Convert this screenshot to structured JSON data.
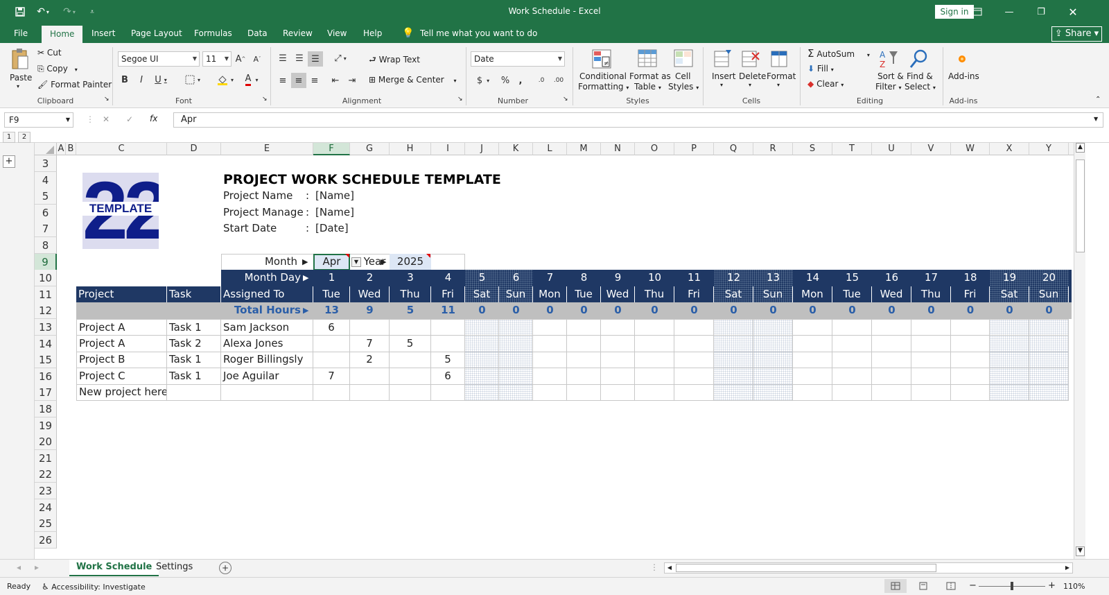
{
  "app": {
    "title": "Work Schedule  -  Excel",
    "sign_in": "Sign in",
    "share": "Share"
  },
  "tabs": [
    "File",
    "Home",
    "Insert",
    "Page Layout",
    "Formulas",
    "Data",
    "Review",
    "View",
    "Help"
  ],
  "tell_me": "Tell me what you want to do",
  "ribbon": {
    "clipboard": {
      "paste": "Paste",
      "cut": "Cut",
      "copy": "Copy",
      "format_painter": "Format Painter",
      "label": "Clipboard"
    },
    "font": {
      "name": "Segoe UI",
      "size": "11",
      "label": "Font"
    },
    "alignment": {
      "wrap_text": "Wrap Text",
      "merge_center": "Merge & Center",
      "label": "Alignment"
    },
    "number": {
      "format": "Date",
      "label": "Number"
    },
    "styles": {
      "conditional": "Conditional",
      "formatting": "Formatting",
      "format_as": "Format as",
      "table": "Table",
      "cell": "Cell",
      "styles_txt": "Styles",
      "label": "Styles"
    },
    "cells": {
      "insert": "Insert",
      "delete": "Delete",
      "format": "Format",
      "label": "Cells"
    },
    "editing": {
      "autosum": "AutoSum",
      "fill": "Fill",
      "clear": "Clear",
      "sort": "Sort &",
      "filter": "Filter",
      "find": "Find &",
      "select": "Select",
      "label": "Editing"
    },
    "addins": {
      "addins": "Add-ins",
      "label": "Add-ins"
    }
  },
  "formula_bar": {
    "name_box": "F9",
    "value": "Apr"
  },
  "outline_levels": [
    "1",
    "2"
  ],
  "columns": [
    "A",
    "B",
    "C",
    "D",
    "E",
    "F",
    "G",
    "H",
    "I",
    "J",
    "K",
    "L",
    "M",
    "N",
    "O",
    "P",
    "Q",
    "R",
    "S",
    "T",
    "U",
    "V",
    "W",
    "X",
    "Y"
  ],
  "rows": [
    "3",
    "4",
    "5",
    "6",
    "7",
    "8",
    "9",
    "10",
    "11",
    "12",
    "13",
    "14",
    "15",
    "16",
    "17",
    "18",
    "19",
    "20",
    "21",
    "22",
    "23",
    "24",
    "25",
    "26"
  ],
  "sheet": {
    "logo_text": "TEMPLATE",
    "logo_number": "22",
    "title": "PROJECT WORK SCHEDULE TEMPLATE",
    "info": [
      {
        "label": "Project Name",
        "sep": ":",
        "value": "[Name]"
      },
      {
        "label": "Project Manager",
        "sep": ":",
        "value": "[Name]"
      },
      {
        "label": "Start Date",
        "sep": ":",
        "value": "[Date]"
      }
    ],
    "month_label": "Month",
    "month_value": "Apr",
    "year_label": "Year",
    "year_value": "2025",
    "month_day_label": "Month Day",
    "headers": {
      "project": "Project",
      "task": "Task",
      "assigned": "Assigned To"
    },
    "total_hours_label": "Total Hours",
    "days": [
      "1",
      "2",
      "3",
      "4",
      "5",
      "6",
      "7",
      "8",
      "9",
      "10",
      "11",
      "12",
      "13",
      "14",
      "15",
      "16",
      "17",
      "18",
      "19",
      "20"
    ],
    "weekdays": [
      "Tue",
      "Wed",
      "Thu",
      "Fri",
      "Sat",
      "Sun",
      "Mon",
      "Tue",
      "Wed",
      "Thu",
      "Fri",
      "Sat",
      "Sun",
      "Mon",
      "Tue",
      "Wed",
      "Thu",
      "Fri",
      "Sat",
      "Sun"
    ],
    "totals": [
      "13",
      "9",
      "5",
      "11",
      "0",
      "0",
      "0",
      "0",
      "0",
      "0",
      "0",
      "0",
      "0",
      "0",
      "0",
      "0",
      "0",
      "0",
      "0",
      "0"
    ],
    "data_rows": [
      {
        "project": "Project A",
        "task": "Task 1",
        "assigned": "Sam Jackson",
        "hours": [
          "6",
          "",
          "",
          ""
        ]
      },
      {
        "project": "Project A",
        "task": "Task 2",
        "assigned": "Alexa Jones",
        "hours": [
          "",
          "7",
          "5",
          ""
        ]
      },
      {
        "project": "Project B",
        "task": "Task 1",
        "assigned": "Roger Billingsly",
        "hours": [
          "",
          "2",
          "",
          "5"
        ]
      },
      {
        "project": "Project C",
        "task": "Task 1",
        "assigned": "Joe Aguilar",
        "hours": [
          "7",
          "",
          "",
          "6"
        ]
      },
      {
        "project": "New project here",
        "task": "",
        "assigned": "",
        "hours": [
          "",
          "",
          "",
          ""
        ]
      }
    ]
  },
  "sheet_tabs": [
    "Work Schedule",
    "Settings"
  ],
  "status": {
    "ready": "Ready",
    "accessibility": "Accessibility: Investigate",
    "zoom": "110%"
  },
  "colors": {
    "excel_green": "#217346",
    "navy": "#1f3864",
    "total_bg": "#bfbfbf"
  }
}
